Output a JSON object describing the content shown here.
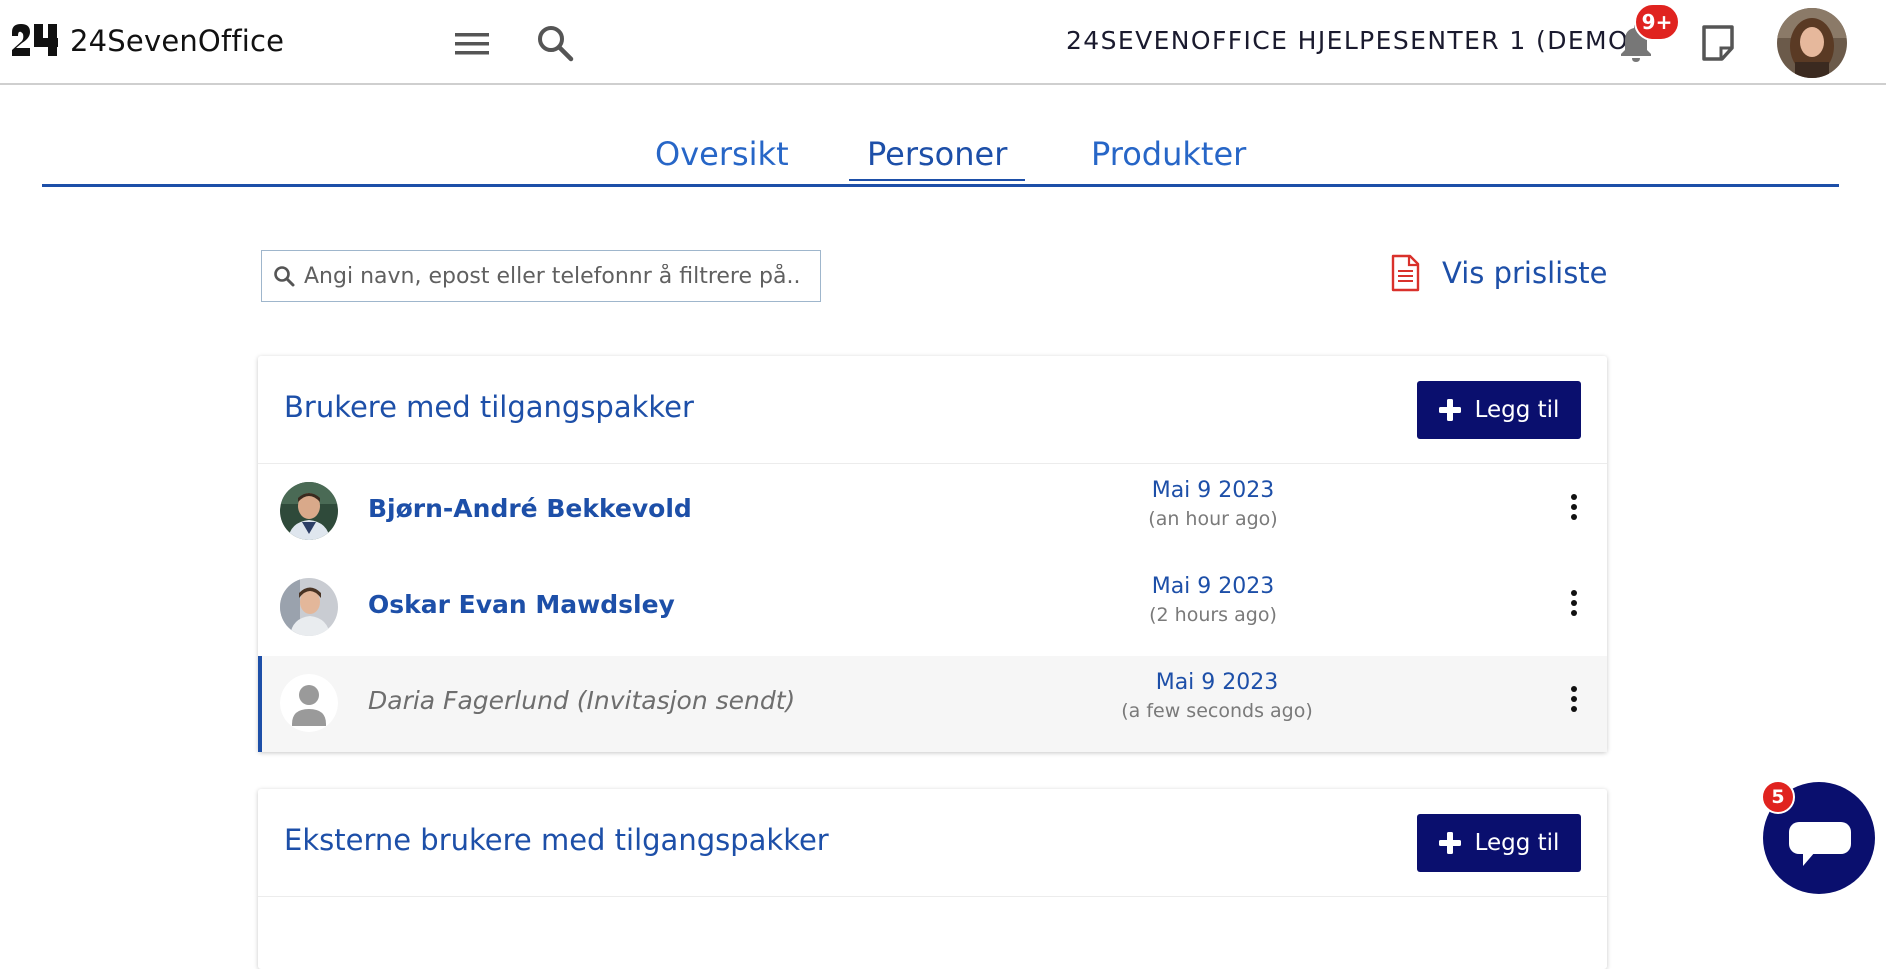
{
  "header": {
    "logo_text": "24SevenOffice",
    "company_name": "24SEVENOFFICE HJELPESENTER 1 (DEMO)",
    "notification_count": "9+"
  },
  "tabs": [
    {
      "label": "Oversikt",
      "active": false
    },
    {
      "label": "Personer",
      "active": true
    },
    {
      "label": "Produkter",
      "active": false
    }
  ],
  "filter": {
    "placeholder": "Angi navn, epost eller telefonnr å filtrere på..",
    "value": ""
  },
  "pricelist_link": "Vis prisliste",
  "users_card": {
    "title": "Brukere med tilgangspakker",
    "add_label": "Legg til",
    "rows": [
      {
        "name": "Bjørn-André Bekkevold",
        "date": "Mai 9 2023",
        "ago": "(an hour ago)"
      },
      {
        "name": "Oskar Evan Mawdsley",
        "date": "Mai 9 2023",
        "ago": "(2 hours ago)"
      },
      {
        "name": "Daria Fagerlund (Invitasjon sendt)",
        "date": "Mai 9 2023",
        "ago": "(a few seconds ago)"
      }
    ]
  },
  "external_card": {
    "title": "Eksterne brukere med tilgangspakker",
    "add_label": "Legg til"
  },
  "chat": {
    "badge": "5"
  },
  "colors": {
    "primary": "#1d4fa8",
    "button_bg": "#0a0f6e",
    "badge_red": "#e0231f"
  }
}
